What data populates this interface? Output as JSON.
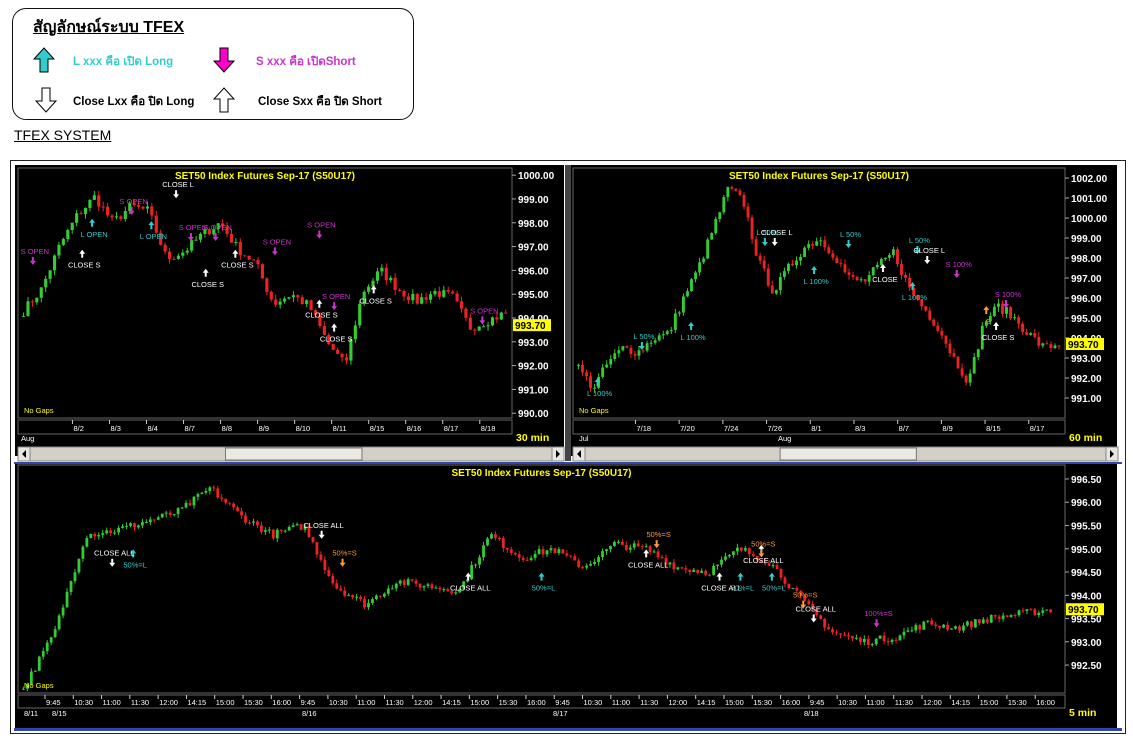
{
  "legend": {
    "title": "สัญลักษณ์ระบบ TFEX",
    "items": [
      {
        "label": "L xxx คือ เปิด Long",
        "color": "#33cccc",
        "icon": "arrow-up-filled-teal"
      },
      {
        "label": "S xxx คือ เปิดShort",
        "color": "#cc33cc",
        "icon": "arrow-down-filled-magenta"
      },
      {
        "label": "Close Lxx คือ ปิด Long",
        "color": "#000000",
        "icon": "arrow-down-outline"
      },
      {
        "label": "Close Sxx คือ ปิด Short",
        "color": "#000000",
        "icon": "arrow-up-outline"
      }
    ]
  },
  "section_title": "TFEX SYSTEM",
  "colors": {
    "up": "#33cc33",
    "down": "#ee2222",
    "bg": "#000000",
    "title": "#ffff00",
    "price_tag": "#ffff00",
    "long": "#33cccc",
    "short": "#cc33cc",
    "close": "#ffffff",
    "fifty": "#ff9933"
  },
  "chart_data": [
    {
      "type": "candlestick",
      "title": "SET50  Index  Futures  Sep-17  (S50U17)",
      "timeframe": "30  min",
      "no_gaps": "No Gaps",
      "last_price": "993.70",
      "y_ticks": [
        "1000.00",
        "999.00",
        "998.00",
        "997.00",
        "996.00",
        "995.00",
        "994.00",
        "993.00",
        "992.00",
        "991.00",
        "990.00"
      ],
      "ylim": [
        989.8,
        1000.3
      ],
      "x_ticks": [
        "8/2",
        "8/3",
        "8/4",
        "8/7",
        "8/8",
        "8/9",
        "8/10",
        "8/11",
        "8/15",
        "8/16",
        "8/17",
        "8/18"
      ],
      "month_labels": [
        "Aug"
      ],
      "close_path": [
        994.3,
        995.2,
        997.0,
        998.3,
        999.1,
        998.0,
        998.7,
        998.5,
        996.5,
        996.8,
        997.5,
        998.0,
        996.9,
        996.3,
        994.6,
        995.0,
        994.5,
        993.0,
        992.0,
        995.1,
        996.0,
        995.2,
        994.7,
        995.1,
        994.9,
        993.6,
        993.9,
        994.2
      ],
      "annotations": [
        {
          "text": "S  OPEN",
          "kind": "short",
          "dir": "down",
          "x": 0.03,
          "y": 996.4
        },
        {
          "text": "CLOSE  S",
          "kind": "close",
          "dir": "up",
          "x": 0.13,
          "y": 996.7
        },
        {
          "text": "L  OPEN",
          "kind": "long",
          "dir": "up",
          "x": 0.15,
          "y": 998.0
        },
        {
          "text": "S  OPEN",
          "kind": "short",
          "dir": "down",
          "x": 0.23,
          "y": 998.5
        },
        {
          "text": "L  OPEN",
          "kind": "long",
          "dir": "up",
          "x": 0.27,
          "y": 997.9
        },
        {
          "text": "CLOSE  L",
          "kind": "close",
          "dir": "down",
          "x": 0.32,
          "y": 999.2
        },
        {
          "text": "S  OPEN",
          "kind": "short",
          "dir": "down",
          "x": 0.35,
          "y": 997.4
        },
        {
          "text": "S  OPEN",
          "kind": "short",
          "dir": "down",
          "x": 0.4,
          "y": 997.4
        },
        {
          "text": "CLOSE  S",
          "kind": "close",
          "dir": "up",
          "x": 0.38,
          "y": 995.9
        },
        {
          "text": "CLOSE  S",
          "kind": "close",
          "dir": "up",
          "x": 0.44,
          "y": 996.7
        },
        {
          "text": "S  OPEN",
          "kind": "short",
          "dir": "down",
          "x": 0.52,
          "y": 996.8
        },
        {
          "text": "S  OPEN",
          "kind": "short",
          "dir": "down",
          "x": 0.61,
          "y": 997.5
        },
        {
          "text": "CLOSE  S",
          "kind": "close",
          "dir": "up",
          "x": 0.61,
          "y": 994.6
        },
        {
          "text": "S  OPEN",
          "kind": "short",
          "dir": "down",
          "x": 0.64,
          "y": 994.5
        },
        {
          "text": "CLOSE  S",
          "kind": "close",
          "dir": "up",
          "x": 0.64,
          "y": 993.6
        },
        {
          "text": "CLOSE  S",
          "kind": "close",
          "dir": "up",
          "x": 0.72,
          "y": 995.2
        },
        {
          "text": "S  OPEN",
          "kind": "short",
          "dir": "down",
          "x": 0.94,
          "y": 993.9
        }
      ]
    },
    {
      "type": "candlestick",
      "title": "SET50  Index  Futures  Sep-17  (S50U17)",
      "timeframe": "60  min",
      "no_gaps": "No Gaps",
      "last_price": "993.70",
      "y_ticks": [
        "1002.00",
        "1001.00",
        "1000.00",
        "999.00",
        "998.00",
        "997.00",
        "996.00",
        "995.00",
        "994.00",
        "993.00",
        "992.00",
        "991.00"
      ],
      "ylim": [
        990.0,
        1002.5
      ],
      "x_ticks": [
        "7/18",
        "7/20",
        "7/24",
        "7/26",
        "8/1",
        "8/3",
        "8/7",
        "8/9",
        "8/15",
        "8/17"
      ],
      "month_labels": [
        "Jul",
        "Aug"
      ],
      "close_path": [
        992.5,
        991.5,
        992.8,
        993.5,
        993.3,
        994.0,
        994.2,
        996.0,
        997.5,
        999.5,
        1001.5,
        1000.8,
        997.8,
        996.3,
        997.5,
        998.5,
        999.0,
        998.2,
        997.0,
        996.8,
        997.6,
        998.3,
        996.5,
        995.5,
        994.5,
        993.0,
        991.8,
        994.8,
        995.6,
        995.0,
        994.2,
        993.5,
        993.7
      ],
      "annotations": [
        {
          "text": "L  100%",
          "kind": "long",
          "dir": "up",
          "x": 0.05,
          "y": 991.8
        },
        {
          "text": "L  50%",
          "kind": "long",
          "dir": "down",
          "x": 0.14,
          "y": 993.6
        },
        {
          "text": "L  100%",
          "kind": "long",
          "dir": "up",
          "x": 0.24,
          "y": 994.6
        },
        {
          "text": "L  50%",
          "kind": "long",
          "dir": "down",
          "x": 0.39,
          "y": 998.8
        },
        {
          "text": "CLOSE  L",
          "kind": "close",
          "dir": "down",
          "x": 0.41,
          "y": 998.8
        },
        {
          "text": "L  100%",
          "kind": "long",
          "dir": "up",
          "x": 0.49,
          "y": 997.4
        },
        {
          "text": "L  50%",
          "kind": "long",
          "dir": "down",
          "x": 0.56,
          "y": 998.7
        },
        {
          "text": "CLOSE",
          "kind": "close",
          "dir": "up",
          "x": 0.63,
          "y": 997.5
        },
        {
          "text": "L  50%",
          "kind": "long",
          "dir": "down",
          "x": 0.7,
          "y": 998.4
        },
        {
          "text": "CLOSE  L",
          "kind": "close",
          "dir": "down",
          "x": 0.72,
          "y": 997.9
        },
        {
          "text": "L  100%",
          "kind": "long",
          "dir": "up",
          "x": 0.69,
          "y": 996.6
        },
        {
          "text": "S  100%",
          "kind": "short",
          "dir": "down",
          "x": 0.78,
          "y": 997.2
        },
        {
          "text": "S  100%",
          "kind": "short",
          "dir": "down",
          "x": 0.88,
          "y": 995.7
        },
        {
          "text": "CLOSE  S",
          "kind": "close",
          "dir": "up",
          "x": 0.86,
          "y": 994.6
        },
        {
          "text": "S",
          "kind": "fifty",
          "dir": "up",
          "x": 0.84,
          "y": 995.4
        }
      ]
    },
    {
      "type": "candlestick",
      "title": "SET50  Index  Futures  Sep-17  (S50U17)",
      "timeframe": "5  min",
      "no_gaps": "No Gaps",
      "last_price": "993.70",
      "y_ticks": [
        "996.50",
        "996.00",
        "995.50",
        "995.00",
        "994.50",
        "994.00",
        "993.50",
        "993.00",
        "992.50"
      ],
      "ylim": [
        991.9,
        996.8
      ],
      "x_ticks": [
        "9:45",
        "10:30",
        "11:00",
        "11:30",
        "12:00",
        "14:15",
        "15:00",
        "15:30",
        "16:00",
        "9:45",
        "10:30",
        "11:00",
        "11:30",
        "12:00",
        "14:15",
        "15:00",
        "15:30",
        "16:00",
        "9:45",
        "10:30",
        "11:00",
        "11:30",
        "12:00",
        "14:15",
        "15:00",
        "15:30",
        "16:00",
        "9:45",
        "10:30",
        "11:00",
        "11:30",
        "12:00",
        "14:15",
        "15:00",
        "15:30",
        "16:00"
      ],
      "date_labels": [
        "8/11",
        "8/15",
        "8/16",
        "8/17",
        "8/18"
      ],
      "close_path": [
        992.0,
        993.2,
        995.3,
        995.4,
        995.6,
        995.8,
        996.3,
        995.7,
        995.3,
        995.5,
        994.2,
        993.8,
        994.3,
        994.2,
        994.1,
        995.3,
        994.8,
        995.0,
        994.6,
        995.1,
        995.0,
        994.6,
        994.5,
        995.0,
        994.7,
        993.9,
        993.2,
        993.0,
        993.1,
        993.4,
        993.3,
        993.5,
        993.6,
        993.7
      ],
      "annotations": [
        {
          "text": "50%=L",
          "kind": "long",
          "dir": "up",
          "x": 0.11,
          "y": 994.9
        },
        {
          "text": "CLOSE  ALL",
          "kind": "close",
          "dir": "down",
          "x": 0.09,
          "y": 994.7
        },
        {
          "text": "CLOSE  ALL",
          "kind": "close",
          "dir": "down",
          "x": 0.29,
          "y": 995.3
        },
        {
          "text": "50%=S",
          "kind": "fifty",
          "dir": "down",
          "x": 0.31,
          "y": 994.7
        },
        {
          "text": "CLOSE  ALL",
          "kind": "close",
          "dir": "up",
          "x": 0.43,
          "y": 994.4
        },
        {
          "text": "50%=L",
          "kind": "long",
          "dir": "up",
          "x": 0.5,
          "y": 994.4
        },
        {
          "text": "50%=S",
          "kind": "fifty",
          "dir": "down",
          "x": 0.61,
          "y": 995.1
        },
        {
          "text": "CLOSE  ALL",
          "kind": "close",
          "dir": "up",
          "x": 0.6,
          "y": 994.9
        },
        {
          "text": "CLOSE  ALL",
          "kind": "close",
          "dir": "up",
          "x": 0.67,
          "y": 994.4
        },
        {
          "text": "50%=L",
          "kind": "long",
          "dir": "up",
          "x": 0.69,
          "y": 994.4
        },
        {
          "text": "CLOSE  ALL",
          "kind": "close",
          "dir": "up",
          "x": 0.71,
          "y": 995.0
        },
        {
          "text": "50%=S",
          "kind": "fifty",
          "dir": "down",
          "x": 0.71,
          "y": 994.9
        },
        {
          "text": "50%=L",
          "kind": "long",
          "dir": "up",
          "x": 0.72,
          "y": 994.4
        },
        {
          "text": "50%=S",
          "kind": "fifty",
          "dir": "down",
          "x": 0.75,
          "y": 993.8
        },
        {
          "text": "CLOSE  ALL",
          "kind": "close",
          "dir": "down",
          "x": 0.76,
          "y": 993.5
        },
        {
          "text": "100%=S",
          "kind": "short",
          "dir": "down",
          "x": 0.82,
          "y": 993.4
        }
      ]
    }
  ]
}
